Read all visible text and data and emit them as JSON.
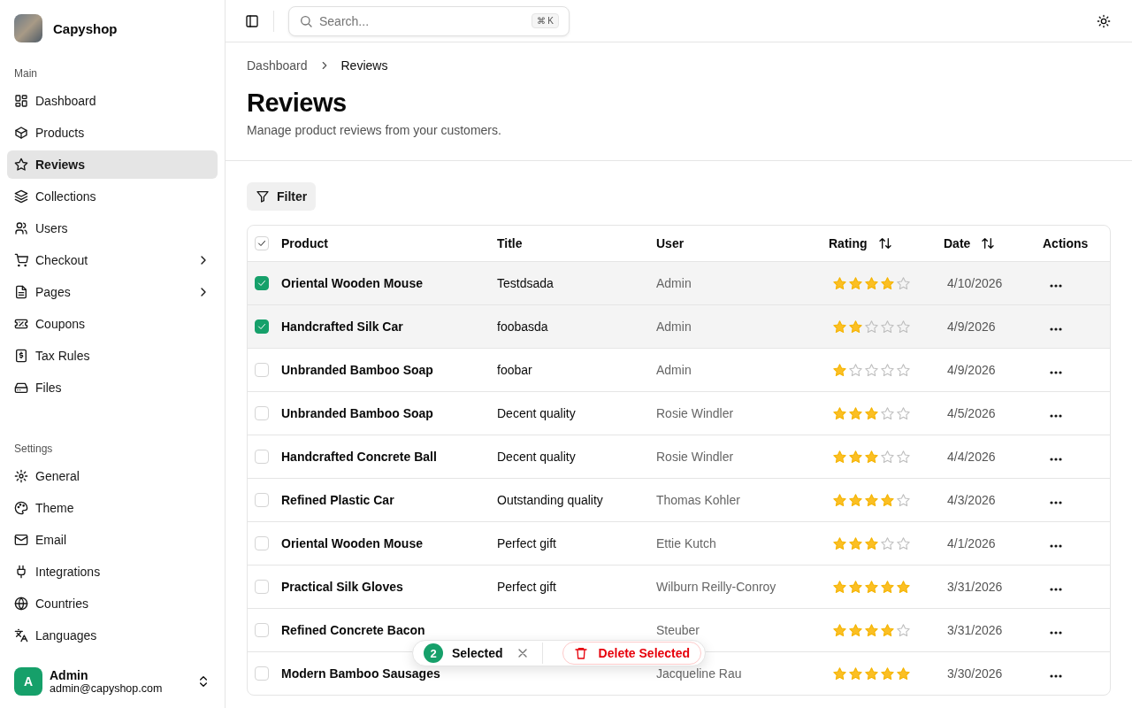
{
  "brand": {
    "name": "Capyshop"
  },
  "sidebar": {
    "sections": [
      {
        "heading": "Main",
        "items": [
          {
            "label": "Dashboard",
            "selected": false,
            "kind": "link"
          },
          {
            "label": "Products",
            "selected": false,
            "kind": "link"
          },
          {
            "label": "Reviews",
            "selected": true,
            "kind": "link"
          },
          {
            "label": "Collections",
            "selected": false,
            "kind": "link"
          },
          {
            "label": "Users",
            "selected": false,
            "kind": "link"
          },
          {
            "label": "Checkout",
            "selected": false,
            "kind": "group"
          },
          {
            "label": "Pages",
            "selected": false,
            "kind": "group"
          },
          {
            "label": "Coupons",
            "selected": false,
            "kind": "link"
          },
          {
            "label": "Tax Rules",
            "selected": false,
            "kind": "link"
          },
          {
            "label": "Files",
            "selected": false,
            "kind": "link"
          }
        ]
      },
      {
        "heading": "Settings",
        "items": [
          {
            "label": "General",
            "selected": false,
            "kind": "link"
          },
          {
            "label": "Theme",
            "selected": false,
            "kind": "link"
          },
          {
            "label": "Email",
            "selected": false,
            "kind": "link"
          },
          {
            "label": "Integrations",
            "selected": false,
            "kind": "link"
          },
          {
            "label": "Countries",
            "selected": false,
            "kind": "link"
          },
          {
            "label": "Languages",
            "selected": false,
            "kind": "link"
          }
        ]
      }
    ],
    "user": {
      "initial": "A",
      "name": "Admin",
      "email": "admin@capyshop.com"
    }
  },
  "search": {
    "placeholder": "Search...",
    "shortcut": "⌘ K"
  },
  "breadcrumb": [
    "Dashboard",
    "Reviews"
  ],
  "page": {
    "title": "Reviews",
    "subtitle": "Manage product reviews from your customers."
  },
  "filter_button": "Filter",
  "table": {
    "select_all": {
      "checked": true
    },
    "columns": [
      {
        "label": "Product",
        "sortable": false
      },
      {
        "label": "Title",
        "sortable": false
      },
      {
        "label": "User",
        "sortable": false
      },
      {
        "label": "Rating",
        "sortable": true
      },
      {
        "label": "Date",
        "sortable": true
      },
      {
        "label": "Actions",
        "sortable": false
      }
    ],
    "rows": [
      {
        "selected": true,
        "product": "Oriental Wooden Mouse",
        "title": "Testdsada",
        "user": "Admin",
        "stars": 4,
        "date": "4/10/2026"
      },
      {
        "selected": true,
        "product": "Handcrafted Silk Car",
        "title": "foobasda",
        "user": "Admin",
        "stars": 2,
        "date": "4/9/2026"
      },
      {
        "selected": false,
        "product": "Unbranded Bamboo Soap",
        "title": "foobar",
        "user": "Admin",
        "stars": 1,
        "date": "4/9/2026"
      },
      {
        "selected": false,
        "product": "Unbranded Bamboo Soap",
        "title": "Decent quality",
        "user": "Rosie Windler",
        "stars": 3,
        "date": "4/5/2026"
      },
      {
        "selected": false,
        "product": "Handcrafted Concrete Ball",
        "title": "Decent quality",
        "user": "Rosie Windler",
        "stars": 3,
        "date": "4/4/2026"
      },
      {
        "selected": false,
        "product": "Refined Plastic Car",
        "title": "Outstanding quality",
        "user": "Thomas Kohler",
        "stars": 4,
        "date": "4/3/2026"
      },
      {
        "selected": false,
        "product": "Oriental Wooden Mouse",
        "title": "Perfect gift",
        "user": "Ettie Kutch",
        "stars": 3,
        "date": "4/1/2026"
      },
      {
        "selected": false,
        "product": "Practical Silk Gloves",
        "title": "Perfect gift",
        "user": "Wilburn Reilly-Conroy",
        "stars": 5,
        "date": "3/31/2026"
      },
      {
        "selected": false,
        "product": "Refined Concrete Bacon",
        "user": "Steuber",
        "stars": 4,
        "date": "3/31/2026"
      },
      {
        "selected": false,
        "product": "Modern Bamboo Sausages",
        "user": "Jacqueline Rau",
        "stars": 5,
        "date": "3/30/2026"
      }
    ]
  },
  "selection_bar": {
    "count": "2",
    "label": "Selected",
    "delete": "Delete Selected"
  }
}
